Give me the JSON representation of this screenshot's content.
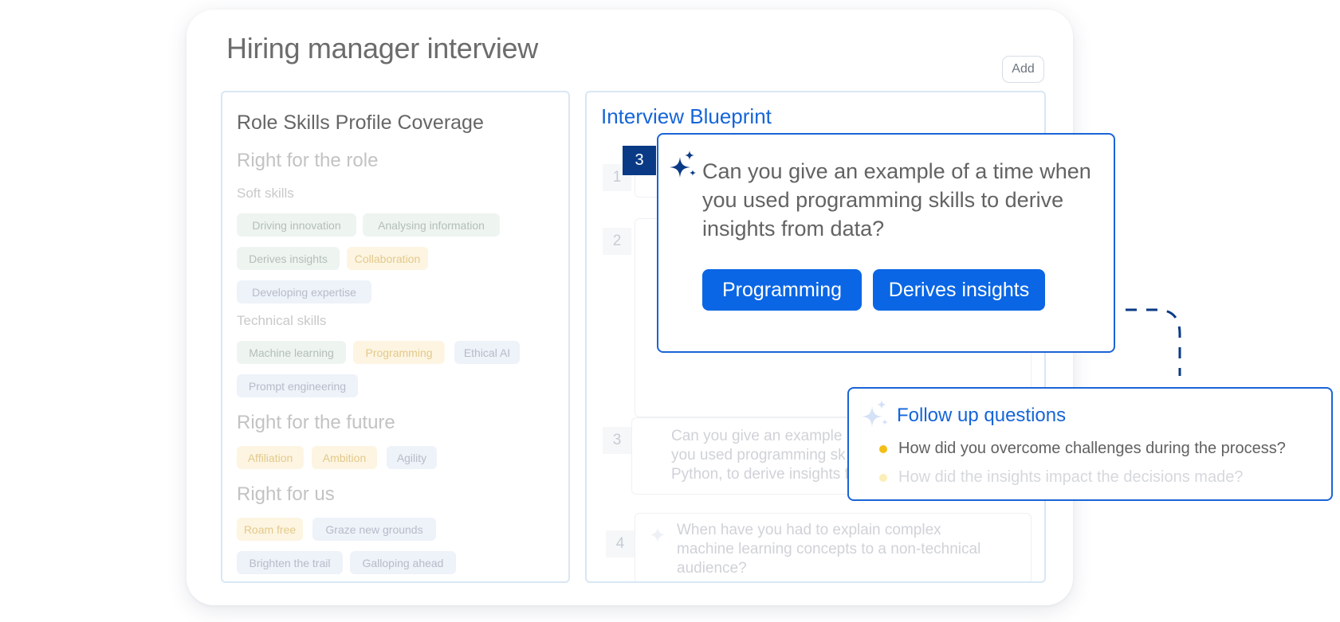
{
  "header": {
    "title": "Hiring manager interview",
    "add_label": "Add"
  },
  "skills_panel": {
    "title": "Role Skills Profile Coverage",
    "role_section": "Right for the role",
    "soft_label": "Soft skills",
    "soft_tags": [
      "Driving innovation",
      "Analysing information",
      "Derives insights",
      "Collaboration",
      "Developing expertise"
    ],
    "tech_label": "Technical skills",
    "tech_tags": [
      "Machine learning",
      "Programming",
      "Ethical AI",
      "Prompt engineering"
    ],
    "future_section": "Right for the future",
    "future_tags": [
      "Affiliation",
      "Ambition",
      "Agility"
    ],
    "us_section": "Right for us",
    "us_tags": [
      "Roam free",
      "Graze new grounds",
      "Brighten the trail",
      "Galloping ahead"
    ]
  },
  "blueprint": {
    "title": "Interview Blueprint",
    "numbers": [
      "1",
      "2",
      "3",
      "4"
    ],
    "q3_text": [
      "Can you give an example",
      "you used programming sk",
      "Python, to derive insights f"
    ],
    "q4_text": [
      "When have you had to explain complex",
      "machine learning concepts to a non-technical",
      "audience?"
    ]
  },
  "focus_question": {
    "number": "3",
    "text": "Can you give an example of a time when you used programming skills to derive insights from data?",
    "chips": [
      "Programming",
      "Derives insights"
    ]
  },
  "follow_up": {
    "title": "Follow up questions",
    "items": [
      "How did you overcome challenges during the process?",
      "How did the insights impact the decisions made?"
    ]
  },
  "colors": {
    "accent": "#0a66e4",
    "badge": "#0a3a86",
    "bullet": "#f3bf17"
  }
}
